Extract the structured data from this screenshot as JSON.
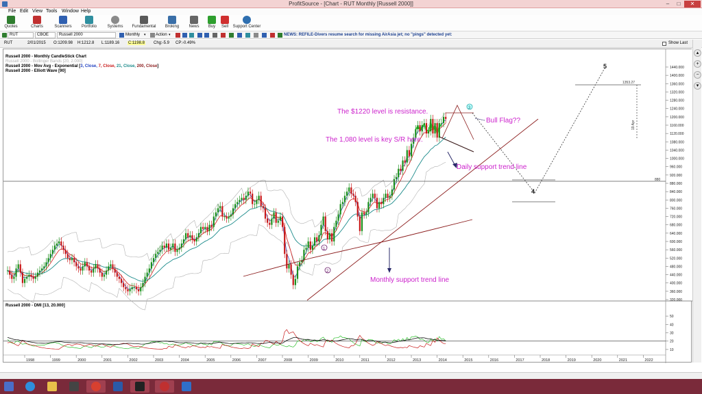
{
  "window": {
    "title": "ProfitSource - [Chart - RUT Monthly [Russell 2000]]",
    "minimize": "–",
    "maximize": "□",
    "close": "✕"
  },
  "menu": [
    "File",
    "Edit",
    "View",
    "Tools",
    "Window",
    "Help"
  ],
  "toolbar": [
    {
      "label": "Quotes",
      "color": "#2f7d2f"
    },
    {
      "label": "Charts",
      "color": "#c03030"
    },
    {
      "label": "Scanners",
      "color": "#3060b0"
    },
    {
      "label": "Portfolio",
      "color": "#2f8f9f"
    },
    {
      "label": "Systems",
      "color": "#8a8a8a"
    },
    {
      "label": "Fundamental",
      "color": "#5a5a5a"
    },
    {
      "label": "Broking",
      "color": "#3a6fa8"
    },
    {
      "label": "News",
      "color": "#666666"
    },
    {
      "label": "Buy",
      "color": "#2f9f2f"
    },
    {
      "label": "Sell",
      "color": "#d03030"
    },
    {
      "label": "Support Center",
      "color": "#2f6fb0"
    }
  ],
  "chartbar": {
    "symbol": "RUT",
    "exchange": "CBOE",
    "name": "Russell 2000",
    "period": "Monthly",
    "action": "Action",
    "news": "NEWS: REFILE-Divers resume search for missing AirAsia jet; no \"pings\" detected yet:"
  },
  "quote": {
    "symbol": "RUT",
    "date": "2/01/2015",
    "open": "O:1209.98",
    "high": "H:1212.8",
    "low": "L:1189.16",
    "close": "C:1198.8",
    "chg": "Chg:-5.9",
    "cp": "CP:-0.49%",
    "show_last": "Show Last"
  },
  "legend": {
    "line1": "Russell 2000 - Monthly CandleStick Chart",
    "line2": "Russell 2000 - Bollinger Bands [20, 2.000]",
    "line3_prefix": "Russell 2000 - Mov Avg - Exponential [",
    "line3_a": "3, Close,",
    "line3_b": " 7, Close,",
    "line3_c": " 21, Close,",
    "line3_d": " 200, Close",
    "line3_suffix": "]",
    "line4": "Russell 2000 - Elliott Wave [90]"
  },
  "annotations": {
    "resistance": "The $1220 level is resistance.",
    "support_key": "The 1,080 level is key S/R here.",
    "bull_flag": "Bull Flag??",
    "daily_trend": "Daily support trend line",
    "monthly_trend": "Monthly support trend line",
    "wave1": "1",
    "wave2": "2",
    "wave3": "3",
    "wave4": "4",
    "wave5": "5",
    "level_880": "880",
    "level_1353": "1353.27",
    "date_label": "19 Apr"
  },
  "dmi_title": "Russell 2000 - DMI [13, 20.000]",
  "colors": {
    "up": "#1a8f1a",
    "down": "#c81818",
    "ema_fast": "#d21818",
    "ema_mid": "#1a8a8a",
    "ema_slow": "#8a1a1a",
    "bollinger": "#b0b0b0",
    "annotation": "#cc22cc",
    "trend": "#8a1a1a",
    "arrow": "#2a2a6a"
  },
  "chart_data": {
    "type": "candlestick",
    "price_axis": [
      "1440.000",
      "1400.000",
      "1360.000",
      "1320.000",
      "1280.000",
      "1240.000",
      "1200.000",
      "1160.000",
      "1120.000",
      "1080.000",
      "1040.000",
      "1000.000",
      "960.000",
      "920.000",
      "880.000",
      "840.000",
      "800.000",
      "760.000",
      "720.000",
      "680.000",
      "640.000",
      "600.000",
      "560.000",
      "520.000",
      "480.000",
      "440.000",
      "400.000",
      "360.000",
      "320.000"
    ],
    "ylim": [
      300,
      1480
    ],
    "years": [
      "1998",
      "1999",
      "2000",
      "2001",
      "2002",
      "2003",
      "2004",
      "2005",
      "2006",
      "2007",
      "2008",
      "2009",
      "2010",
      "2011",
      "2012",
      "2013",
      "2014",
      "2015",
      "2016",
      "2017",
      "2018",
      "2019",
      "2020",
      "2021",
      "2022"
    ],
    "dmi_axis": [
      "50",
      "40",
      "30",
      "20",
      "10"
    ],
    "dmi_ylim": [
      5,
      55
    ],
    "closes_by_year": [
      [
        460,
        440,
        420,
        430,
        470,
        490,
        450,
        400,
        420,
        430,
        440,
        430
      ],
      [
        420,
        430,
        450,
        460,
        470,
        480,
        500,
        520,
        540,
        560,
        580,
        590
      ],
      [
        600,
        580,
        560,
        540,
        520,
        510,
        520,
        500,
        480,
        470,
        460,
        480
      ],
      [
        500,
        480,
        460,
        450,
        470,
        490,
        470,
        450,
        430,
        440,
        460,
        480
      ],
      [
        490,
        470,
        450,
        430,
        420,
        400,
        380,
        370,
        360,
        370,
        380,
        380
      ],
      [
        370,
        360,
        380,
        400,
        430,
        450,
        470,
        500,
        520,
        540,
        550,
        560
      ],
      [
        580,
        570,
        590,
        560,
        570,
        590,
        550,
        560,
        570,
        590,
        610,
        640
      ],
      [
        620,
        630,
        610,
        600,
        620,
        640,
        670,
        660,
        670,
        650,
        680,
        670
      ],
      [
        720,
        740,
        760,
        770,
        720,
        720,
        710,
        720,
        730,
        760,
        780,
        790
      ],
      [
        800,
        810,
        800,
        820,
        840,
        830,
        780,
        780,
        800,
        820,
        770,
        760
      ],
      [
        710,
        690,
        680,
        710,
        740,
        690,
        700,
        720,
        670,
        540,
        470,
        490
      ],
      [
        440,
        390,
        420,
        480,
        500,
        510,
        560,
        570,
        600,
        560,
        580,
        620
      ],
      [
        600,
        630,
        680,
        720,
        650,
        610,
        640,
        600,
        670,
        700,
        730,
        780
      ],
      [
        790,
        820,
        840,
        860,
        830,
        820,
        790,
        720,
        650,
        740,
        730,
        740
      ],
      [
        790,
        810,
        830,
        810,
        760,
        790,
        780,
        810,
        830,
        810,
        820,
        850
      ],
      [
        900,
        910,
        950,
        940,
        990,
        980,
        1040,
        1010,
        1070,
        1100,
        1140,
        1160
      ],
      [
        1130,
        1160,
        1170,
        1120,
        1130,
        1190,
        1120,
        1170,
        1100,
        1170,
        1170,
        1200
      ],
      [
        1190
      ]
    ]
  }
}
